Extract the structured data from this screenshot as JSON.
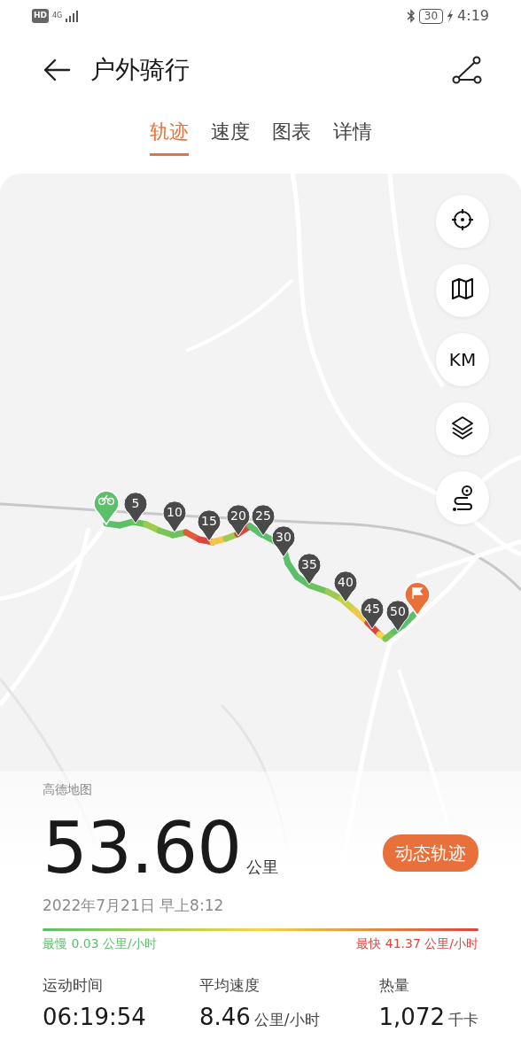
{
  "status_bar": {
    "hd": "HD",
    "network": "4G",
    "battery": "30",
    "charging": true,
    "time": "4:19"
  },
  "header": {
    "title": "户外骑行"
  },
  "tabs": [
    {
      "label": "轨迹",
      "selected": true
    },
    {
      "label": "速度",
      "selected": false
    },
    {
      "label": "图表",
      "selected": false
    },
    {
      "label": "详情",
      "selected": false
    }
  ],
  "map": {
    "attribution": "高德地图",
    "controls": [
      {
        "kind": "locate"
      },
      {
        "kind": "map"
      },
      {
        "kind": "units",
        "label": "KM"
      },
      {
        "kind": "layers"
      },
      {
        "kind": "route"
      }
    ],
    "markers": [
      {
        "kind": "start"
      },
      {
        "kind": "km",
        "label": "5"
      },
      {
        "kind": "km",
        "label": "10"
      },
      {
        "kind": "km",
        "label": "15"
      },
      {
        "kind": "km",
        "label": "20"
      },
      {
        "kind": "km",
        "label": "25"
      },
      {
        "kind": "km",
        "label": "30"
      },
      {
        "kind": "km",
        "label": "35"
      },
      {
        "kind": "km",
        "label": "40"
      },
      {
        "kind": "km",
        "label": "45"
      },
      {
        "kind": "km",
        "label": "50"
      },
      {
        "kind": "finish"
      }
    ]
  },
  "summary": {
    "distance": "53.60",
    "distance_unit": "公里",
    "replay_button": "动态轨迹",
    "date": "2022年7月21日 早上8:12",
    "slowest": "最慢 0.03 公里/小时",
    "fastest": "最快 41.37 公里/小时"
  },
  "stats": [
    {
      "label": "运动时间",
      "value": "06:19:54"
    },
    {
      "label": "平均速度",
      "value": "8.46",
      "unit": "公里/小时"
    },
    {
      "label": "热量",
      "value": "1,072",
      "unit": "千卡"
    }
  ]
}
